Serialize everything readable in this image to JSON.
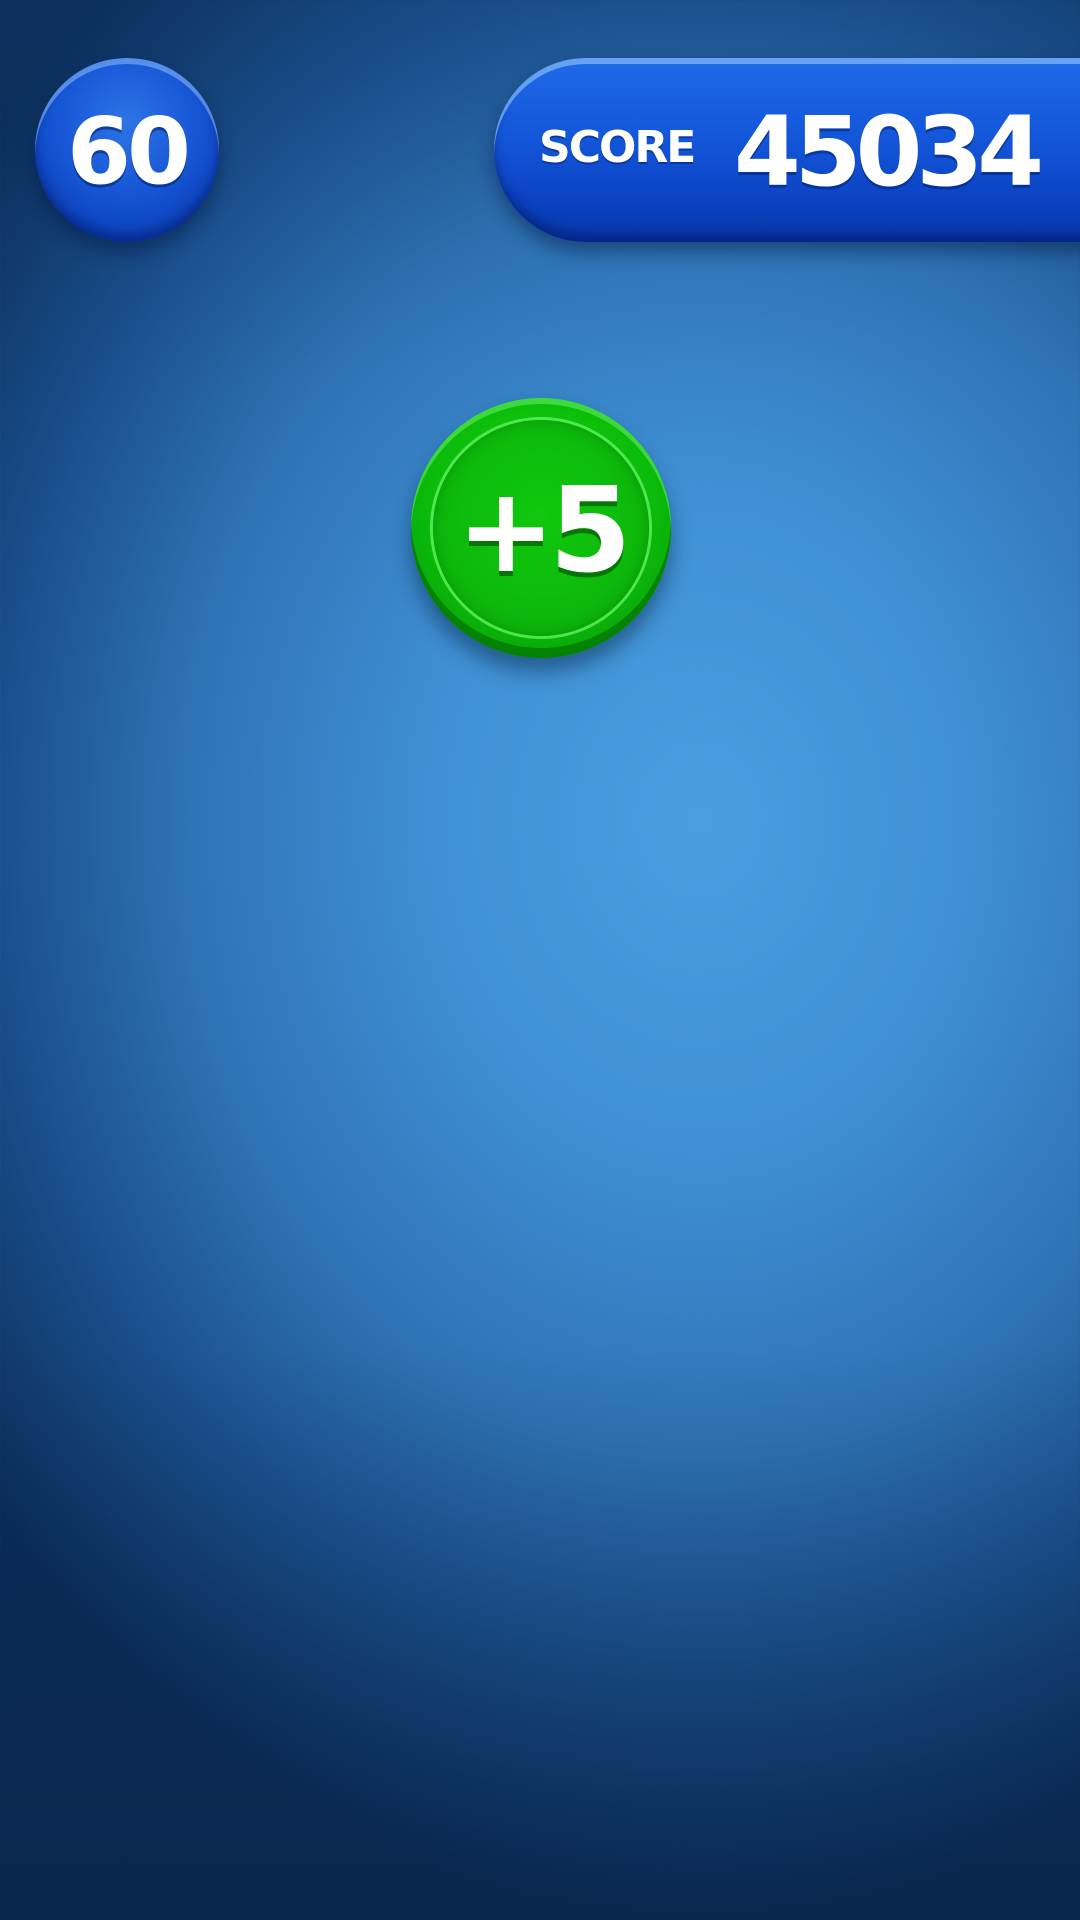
{
  "hud": {
    "timer": "60",
    "score_label": "SCORE",
    "score_value": "45034"
  },
  "bonus": {
    "label": "+5"
  },
  "colors": {
    "background": "#3f90d4",
    "hud_blue": "#1458db",
    "bonus_green": "#0bbb0a",
    "text": "#ffffff"
  }
}
